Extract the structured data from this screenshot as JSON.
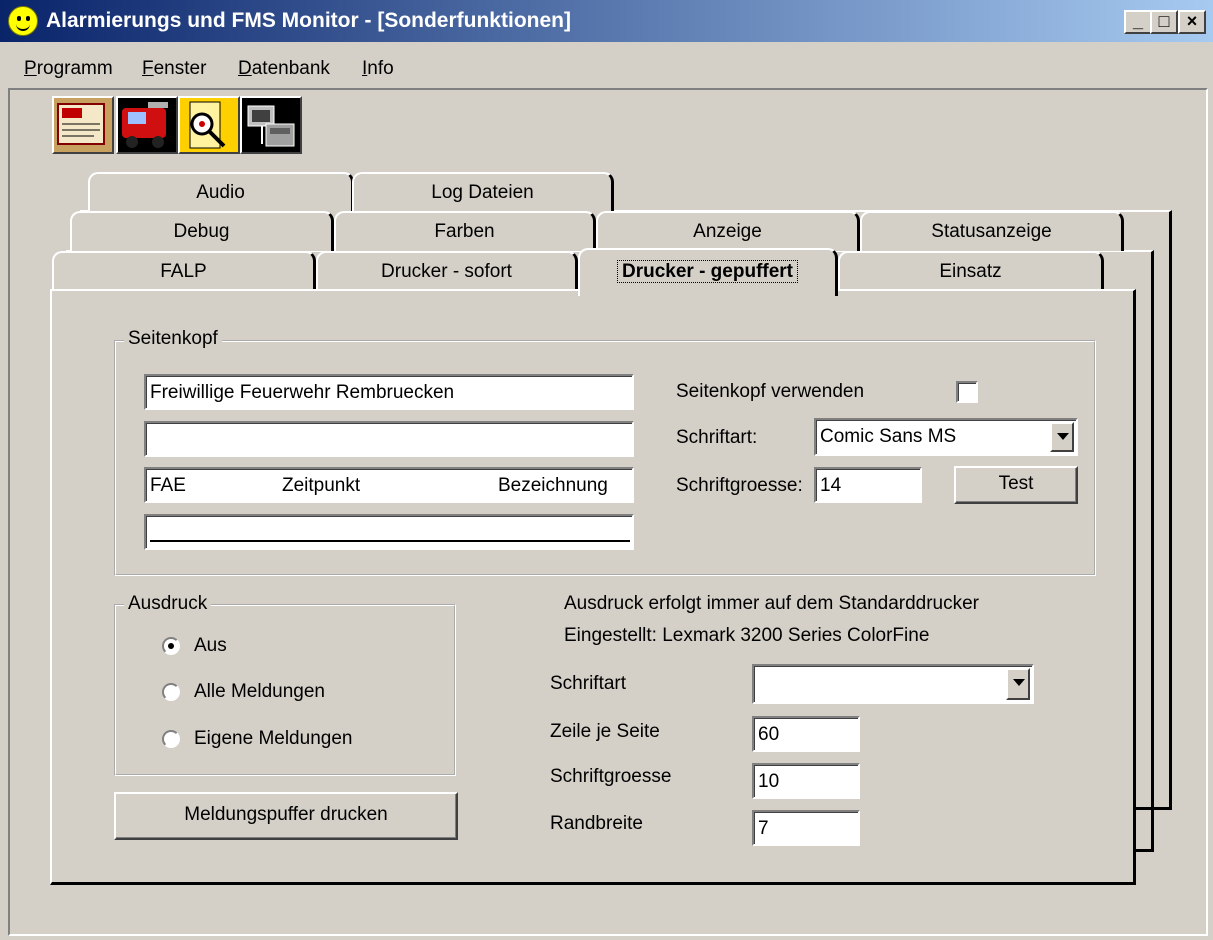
{
  "window": {
    "title": "Alarmierungs und FMS Monitor - [Sonderfunktionen]",
    "minimize_glyph": "_",
    "restore_glyph": "□",
    "close_glyph": "×"
  },
  "menu": [
    {
      "mnemonic": "P",
      "rest": "rogramm"
    },
    {
      "mnemonic": "F",
      "rest": "enster"
    },
    {
      "mnemonic": "D",
      "rest": "atenbank"
    },
    {
      "mnemonic": "I",
      "rest": "nfo"
    }
  ],
  "toolbar_icons": [
    "alarm-log-icon",
    "fire-truck-icon",
    "magnifier-search-icon",
    "network-computer-icon"
  ],
  "tabs": {
    "row1": [
      "Audio",
      "Log Dateien"
    ],
    "row2": [
      "Debug",
      "Farben",
      "Anzeige",
      "Statusanzeige"
    ],
    "row3": [
      "FALP",
      "Drucker - sofort",
      "Drucker - gepuffert",
      "Einsatz"
    ],
    "active": "Drucker - gepuffert"
  },
  "seitenkopf": {
    "group_title": "Seitenkopf",
    "line1": "Freiwillige Feuerwehr Rembruecken",
    "line2": "",
    "line3_cols": [
      "FAE",
      "Zeitpunkt",
      "Bezeichnung"
    ],
    "line4": "",
    "use_label": "Seitenkopf verwenden",
    "use_checked": false,
    "font_label": "Schriftart:",
    "font_value": "Comic Sans MS",
    "size_label": "Schriftgroesse:",
    "size_value": "14",
    "test_button": "Test"
  },
  "ausdruck": {
    "group_title": "Ausdruck",
    "options": [
      "Aus",
      "Alle Meldungen",
      "Eigene Meldungen"
    ],
    "selected": "Aus",
    "print_button": "Meldungspuffer drucken"
  },
  "printer": {
    "info_line1": "Ausdruck erfolgt immer auf dem Standarddrucker",
    "info_line2": "Eingestellt: Lexmark 3200 Series ColorFine",
    "font_label": "Schriftart",
    "font_value": "",
    "lines_label": "Zeile je Seite",
    "lines_value": "60",
    "size_label": "Schriftgroesse",
    "size_value": "10",
    "margin_label": "Randbreite",
    "margin_value": "7"
  }
}
